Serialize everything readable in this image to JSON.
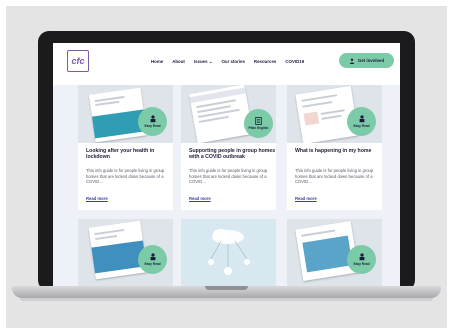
{
  "header": {
    "logo_text": "cfc",
    "nav": [
      "Home",
      "About",
      "Issues",
      "Our stories",
      "Resources",
      "COVID19"
    ],
    "cta_label": "Get involved"
  },
  "cards": [
    {
      "badge": "Easy Read",
      "title": "Looking after your health in lockdown",
      "text": "This info guide is for people living in group homes that are locked down because of a COVID…",
      "link": "Read more"
    },
    {
      "badge": "Plain English",
      "title": "Supporting people in group homes with a COVID outbreak",
      "text": "This info guide is for people living in group homes that are locked down because of a COVID…",
      "link": "Read more"
    },
    {
      "badge": "Easy Read",
      "title": "What is happening in my home",
      "text": "This info guide is for people living in group homes that are locked down because of a COVID…",
      "link": "Read more"
    },
    {
      "badge": "Easy Read"
    },
    {
      "badge": ""
    },
    {
      "badge": "Easy Read"
    }
  ],
  "colors": {
    "accent": "#7ccba8",
    "text": "#1c1c3a",
    "link": "#3a3f9a",
    "background": "#eef1f7",
    "logo": "#7b5aa8"
  }
}
